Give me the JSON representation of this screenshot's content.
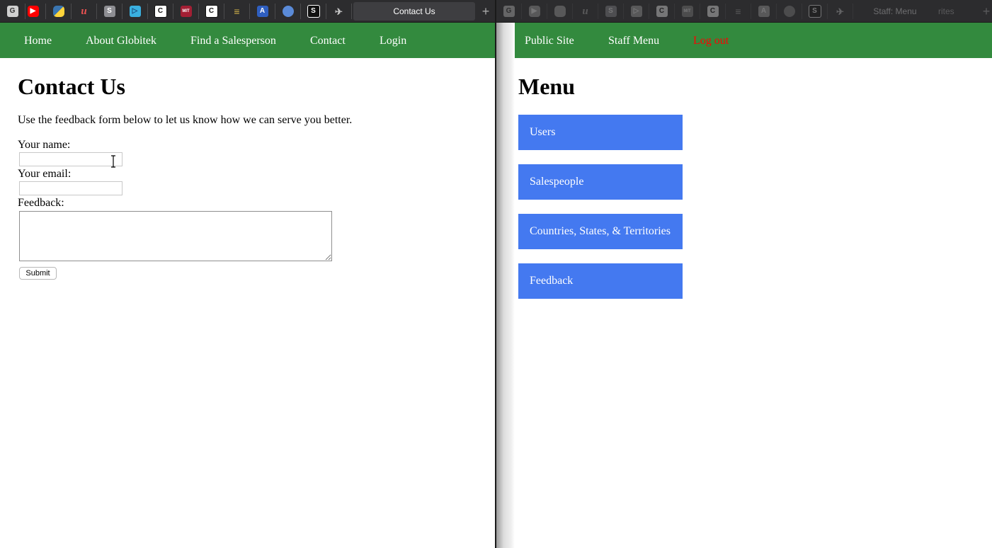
{
  "left_window": {
    "tabs": [
      {
        "icon": "globitek-icon",
        "color": "#d0d0d0"
      },
      {
        "icon": "youtube-icon",
        "color": "#ff0000"
      },
      {
        "icon": "python-icon",
        "color": "#3a75b0"
      },
      {
        "icon": "udemy-icon",
        "color": "#ec5252"
      },
      {
        "icon": "s-app-icon",
        "color": "#8e8e93"
      },
      {
        "icon": "play-icon",
        "color": "#3ab0e0"
      },
      {
        "icon": "codecademy-icon",
        "color": "#ffffff"
      },
      {
        "icon": "mit-ocw-icon",
        "color": "#a31f34"
      },
      {
        "icon": "codecademy-icon",
        "color": "#ffffff"
      },
      {
        "icon": "lines-icon",
        "color": "#d4b44a"
      },
      {
        "icon": "a-app-icon",
        "color": "#2f5fc0"
      },
      {
        "icon": "globe-icon",
        "color": "#5a8ad8"
      },
      {
        "icon": "s-stripe-icon",
        "color": "#111111"
      },
      {
        "icon": "bird-icon",
        "color": "#c8c8c8"
      }
    ],
    "active_tab_title": "Contact Us",
    "nav": [
      "Home",
      "About Globitek",
      "Find a Salesperson",
      "Contact",
      "Login"
    ],
    "heading": "Contact Us",
    "intro": "Use the feedback form below to let us know how we can serve you better.",
    "form": {
      "name_label": "Your name:",
      "name_value": "",
      "email_label": "Your email:",
      "email_value": "",
      "feedback_label": "Feedback:",
      "feedback_value": "",
      "submit_label": "Submit"
    }
  },
  "right_window": {
    "active_tab_title": "Staff: Menu",
    "partial_tab_title": "rites",
    "nav": [
      "Public Site",
      "Staff Menu"
    ],
    "logout_label": "Log out",
    "logout_color": "#ff0000",
    "heading": "Menu",
    "menu_items": [
      "Users",
      "Salespeople",
      "Countries, States, & Territories",
      "Feedback"
    ],
    "menu_color": "#4479f0"
  },
  "nav_color": "#338a3e"
}
